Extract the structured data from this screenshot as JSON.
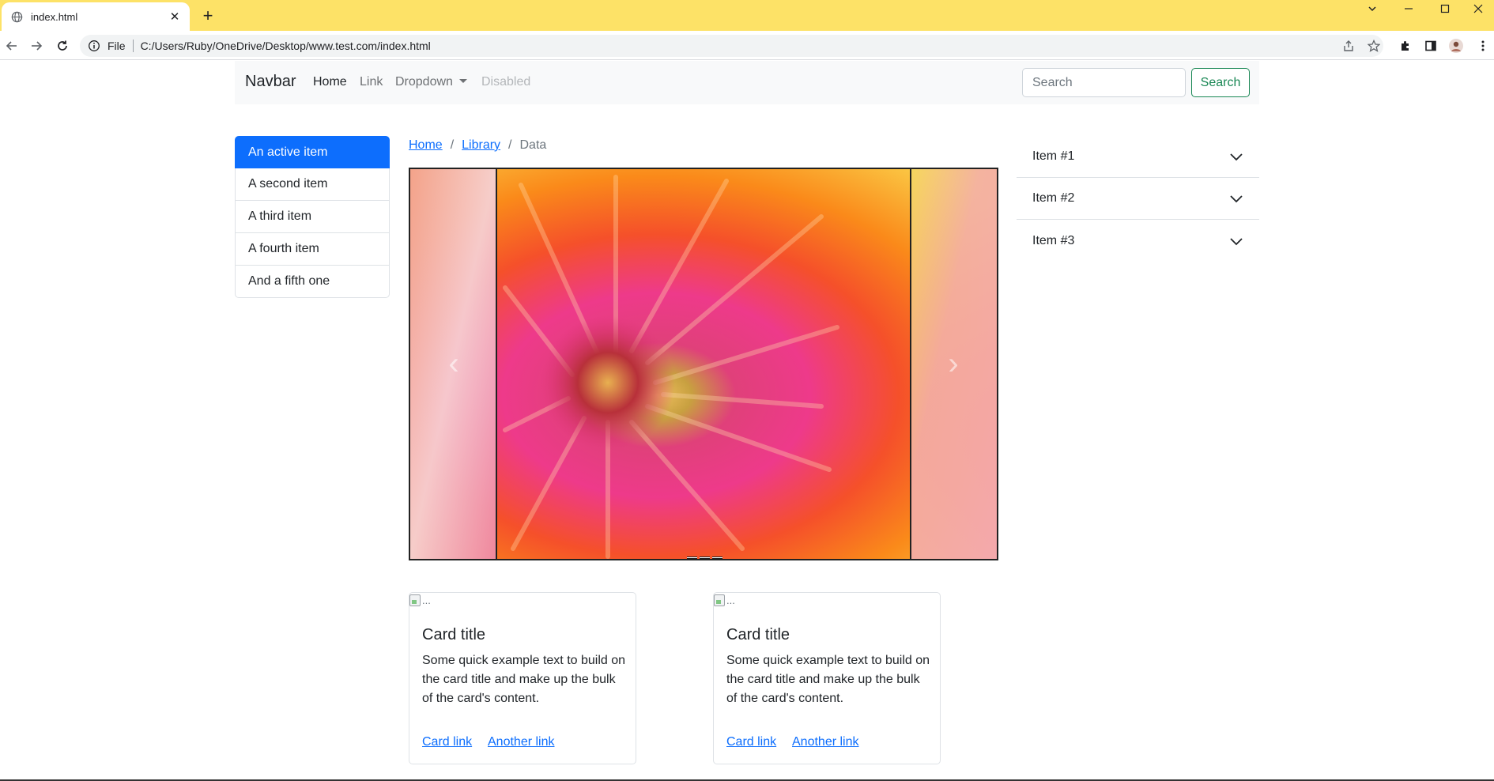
{
  "browser": {
    "tab_title": "index.html",
    "tab_favicon": "globe-icon",
    "omnibox_scheme": "File",
    "url": "C:/Users/Ruby/OneDrive/Desktop/www.test.com/index.html"
  },
  "navbar": {
    "brand": "Navbar",
    "links": [
      "Home",
      "Link",
      "Dropdown",
      "Disabled"
    ],
    "search_placeholder": "Search",
    "search_button": "Search",
    "accent_color": "#198754"
  },
  "list_group": {
    "items": [
      "An active item",
      "A second item",
      "A third item",
      "A fourth item",
      "And a fifth one"
    ],
    "active_color": "#0d6efd"
  },
  "breadcrumb": {
    "items": [
      "Home",
      "Library",
      "Data"
    ]
  },
  "carousel": {
    "prev_icon": "chevron-left-icon",
    "next_icon": "chevron-right-icon",
    "indicator_count": 3
  },
  "accordion": {
    "items": [
      "Item #1",
      "Item #2",
      "Item #3"
    ]
  },
  "cards": [
    {
      "img_alt": "...",
      "title": "Card title",
      "text": "Some quick example text to build on the card title and make up the bulk of the card's content.",
      "link1": "Card link",
      "link2": "Another link"
    },
    {
      "img_alt": "...",
      "title": "Card title",
      "text": "Some quick example text to build on the card title and make up the bulk of the card's content.",
      "link1": "Card link",
      "link2": "Another link"
    }
  ]
}
